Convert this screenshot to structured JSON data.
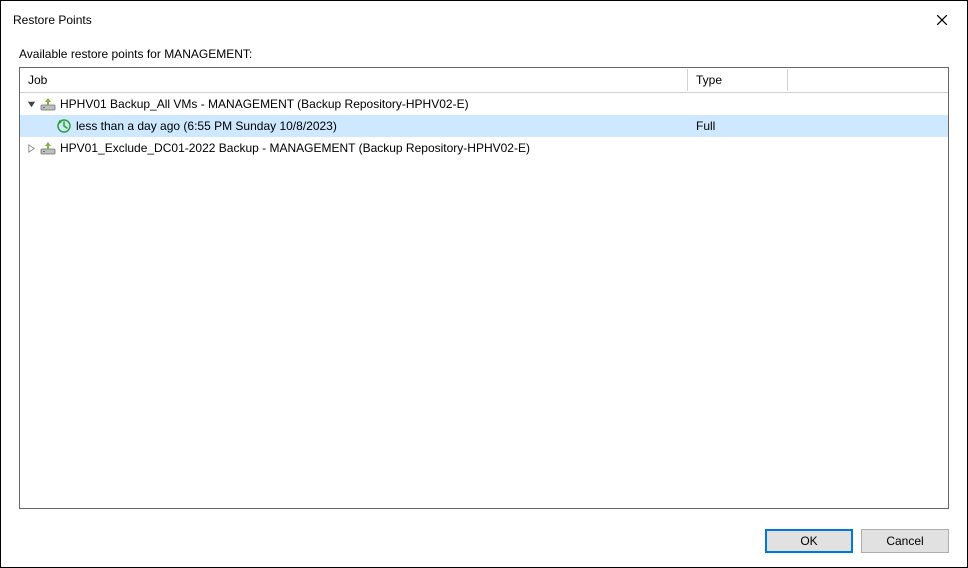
{
  "titlebar": {
    "title": "Restore Points"
  },
  "subtitle": "Available restore points for MANAGEMENT:",
  "grid": {
    "headers": {
      "job": "Job",
      "type": "Type"
    },
    "rows": [
      {
        "kind": "job",
        "expanded": true,
        "label": "HPHV01 Backup_All VMs - MANAGEMENT (Backup Repository-HPHV02-E)",
        "type": ""
      },
      {
        "kind": "point",
        "selected": true,
        "label": "less than a day ago (6:55 PM Sunday 10/8/2023)",
        "type": "Full"
      },
      {
        "kind": "job",
        "expanded": false,
        "label": "HPV01_Exclude_DC01-2022 Backup - MANAGEMENT (Backup Repository-HPHV02-E)",
        "type": ""
      }
    ]
  },
  "buttons": {
    "ok": "OK",
    "cancel": "Cancel"
  }
}
